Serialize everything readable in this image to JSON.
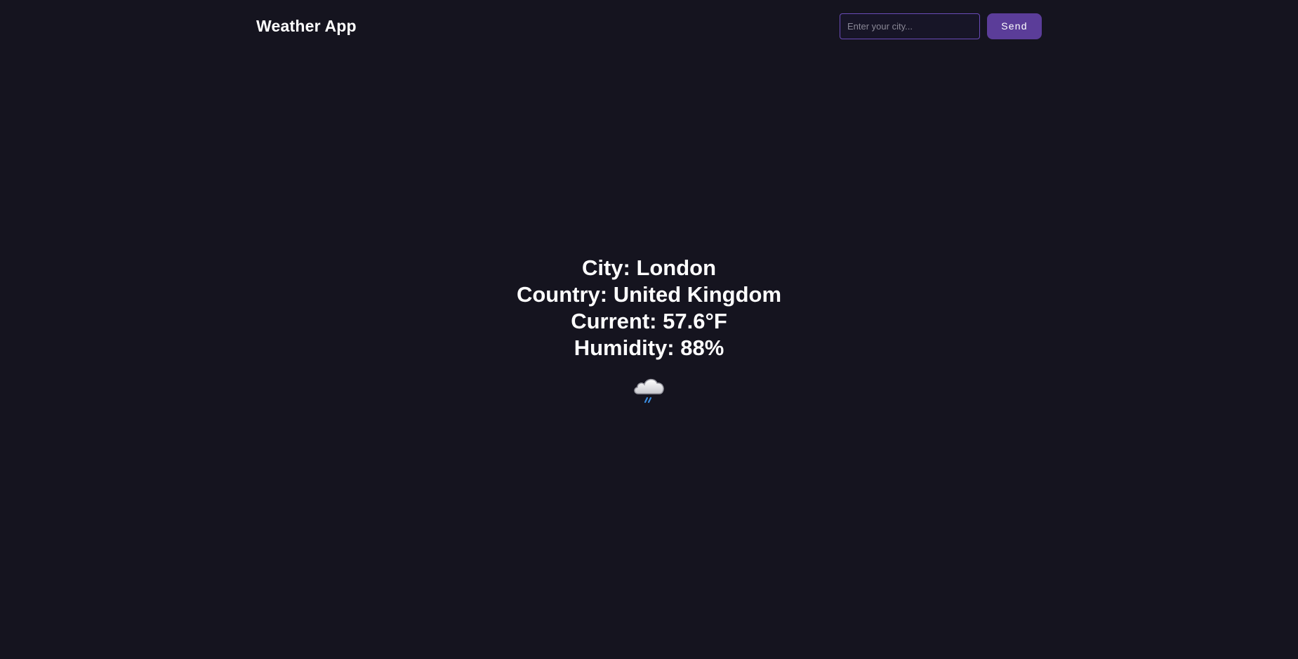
{
  "header": {
    "title": "Weather App",
    "search": {
      "placeholder": "Enter your city...",
      "value": ""
    },
    "send_label": "Send"
  },
  "weather": {
    "city_line": "City: London",
    "country_line": "Country: United Kingdom",
    "current_line": "Current: 57.6°F",
    "humidity_line": "Humidity: 88%",
    "icon": "rain-cloud-icon"
  },
  "colors": {
    "background": "#15141f",
    "accent": "#5b3d99",
    "input_border": "#6a4bb8",
    "rain": "#3b8de0"
  }
}
